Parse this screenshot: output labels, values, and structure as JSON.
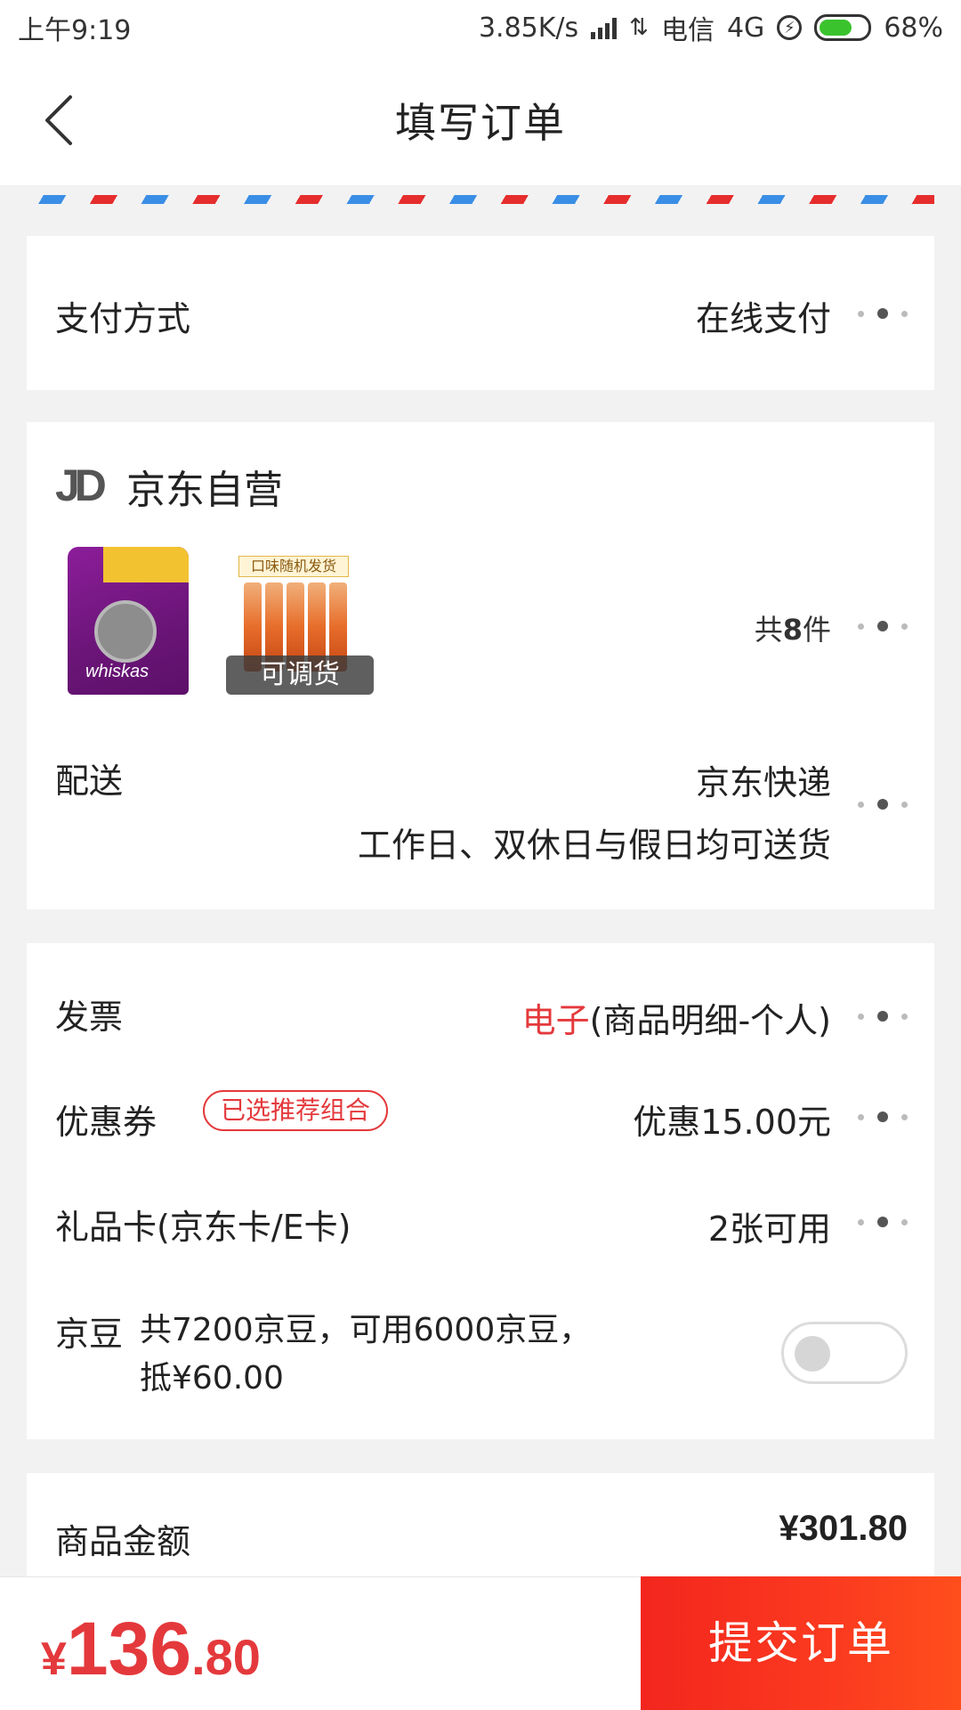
{
  "status_bar": {
    "time": "上午9:19",
    "speed": "3.85K/s",
    "carrier": "电信",
    "network": "4G",
    "battery": "68%",
    "battery_level": 0.68
  },
  "header": {
    "title": "填写订单",
    "back_icon": "chevron-left-icon"
  },
  "payment": {
    "label": "支付方式",
    "value": "在线支付"
  },
  "shop": {
    "name": "京东自营",
    "logo_text": "JD",
    "product_2_tag": "口味随机发货",
    "transfer_badge": "可调货",
    "count_prefix": "共",
    "count": "8",
    "count_suffix": "件"
  },
  "delivery": {
    "label": "配送",
    "carrier": "京东快递",
    "schedule": "工作日、双休日与假日均可送货"
  },
  "invoice": {
    "label": "发票",
    "type_highlight": "电子",
    "type_detail": "(商品明细-个人)"
  },
  "coupon": {
    "label": "优惠券",
    "tag": "已选推荐组合",
    "value": "优惠15.00元"
  },
  "gift_card": {
    "label": "礼品卡(京东卡/E卡)",
    "value": "2张可用"
  },
  "jingdou": {
    "label": "京豆",
    "desc_line1": "共7200京豆，可用6000京豆，",
    "desc_line2": "抵¥60.00",
    "enabled": false
  },
  "amount": {
    "label": "商品金额",
    "value": "¥301.80"
  },
  "bottom": {
    "currency": "¥",
    "total_int": "136",
    "total_dec": ".80",
    "submit_label": "提交订单"
  },
  "colors": {
    "accent": "#e4393c",
    "submit_bg": "#f3261e",
    "battery": "#3bc32e"
  }
}
